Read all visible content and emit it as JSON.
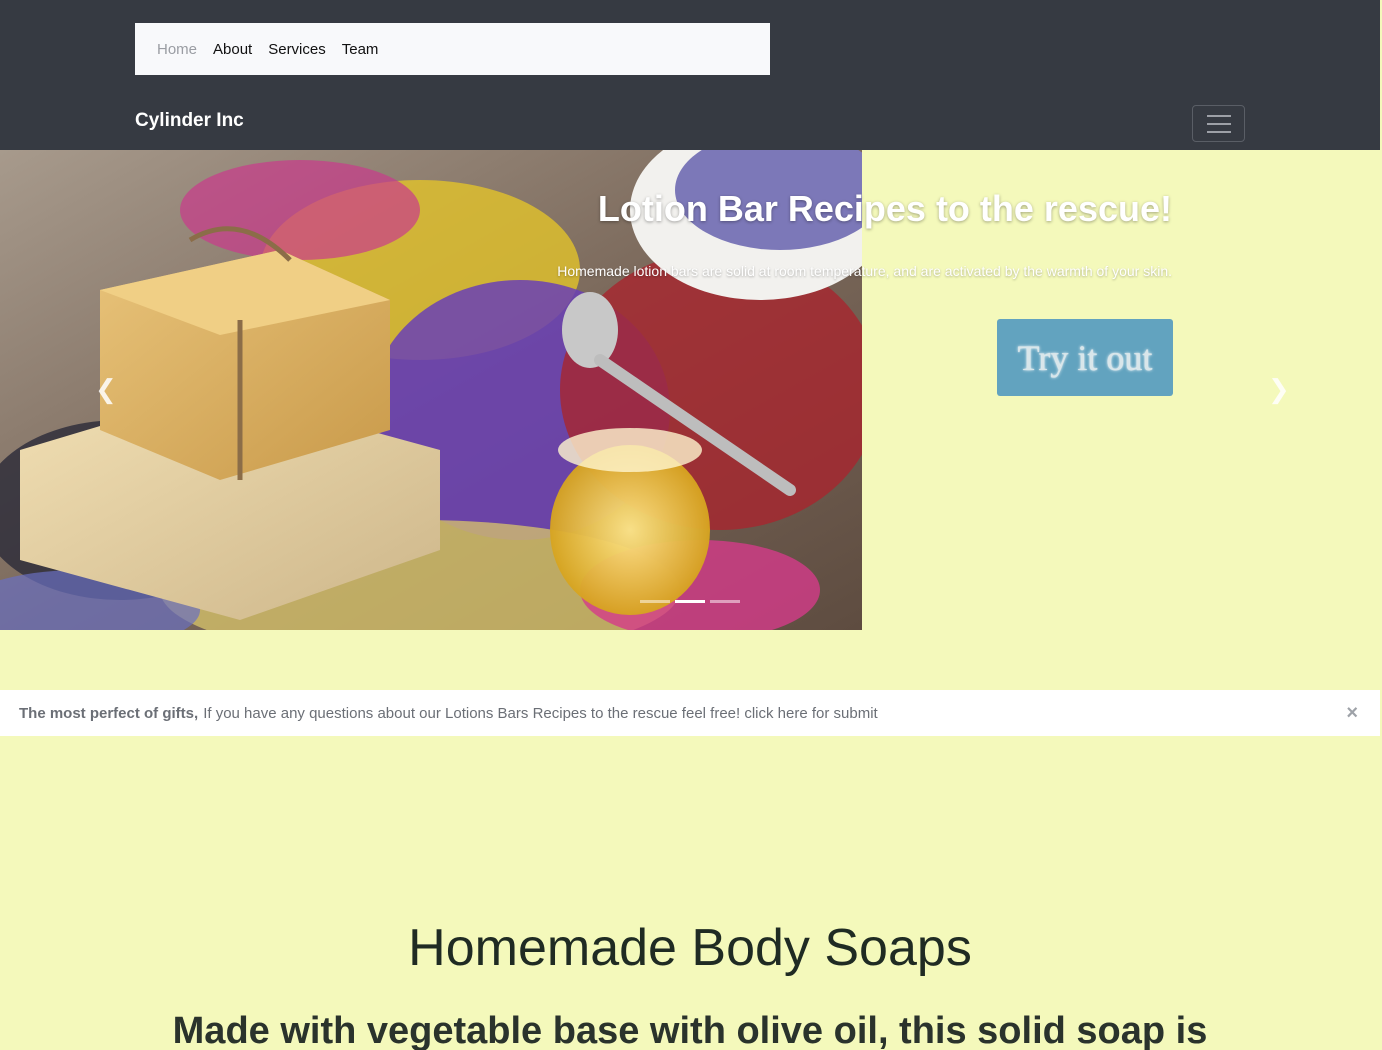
{
  "nav": {
    "items": [
      {
        "label": "Home",
        "active": true
      },
      {
        "label": "About"
      },
      {
        "label": "Services"
      },
      {
        "label": "Team"
      }
    ]
  },
  "navbar": {
    "brand": "Cylinder Inc",
    "toggler_icon": "hamburger-icon"
  },
  "carousel": {
    "title": "Lotion Bar Recipes to the rescue!",
    "text": "Homemade lotion bars are solid at room temperature, and are activated by the warmth of your skin.",
    "button_label": "Try it out",
    "prev_icon": "chevron-left-icon",
    "next_icon": "chevron-right-icon",
    "slide_count": 3,
    "active_slide": 2
  },
  "alert": {
    "strong": "The most perfect of gifts,",
    "text": "If you have any questions about our Lotions Bars Recipes to the rescue feel free! click here for submit",
    "close_label": "×"
  },
  "section": {
    "title": "Homemade Body Soaps",
    "subtitle": "Made with vegetable base with olive oil, this solid soap is"
  },
  "colors": {
    "header_bg": "#363a42",
    "page_bg": "#f4f9bb",
    "button_bg": "#62a3bf"
  }
}
